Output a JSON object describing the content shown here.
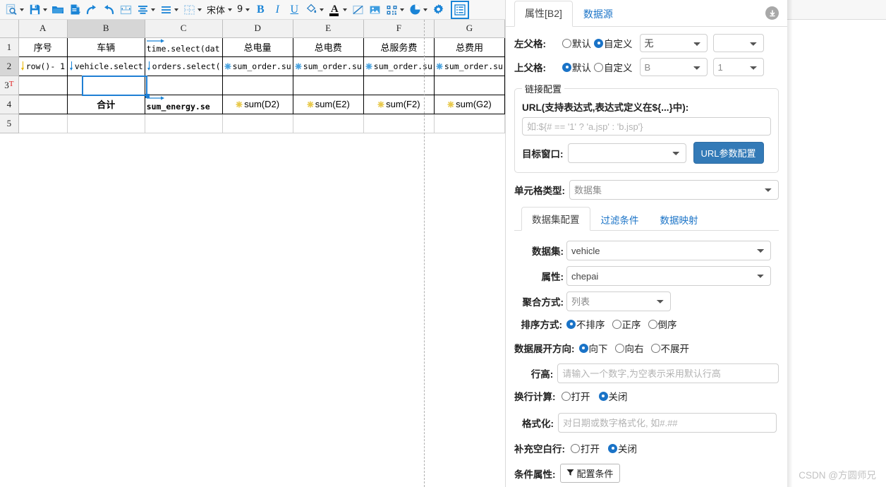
{
  "toolbar": {
    "items": [
      {
        "icon": "print-preview-icon",
        "label": "",
        "caret": true
      },
      {
        "icon": "save-icon",
        "label": "",
        "caret": true
      },
      {
        "icon": "open-folder-icon",
        "label": "",
        "caret": false
      },
      {
        "icon": "new-report-icon",
        "label": "",
        "caret": false
      },
      {
        "icon": "redo-icon",
        "label": "",
        "caret": false
      },
      {
        "icon": "undo-icon",
        "label": "",
        "caret": false
      },
      {
        "icon": "merge-cells-icon",
        "label": "",
        "caret": false
      },
      {
        "icon": "align-center-icon",
        "label": "",
        "caret": true
      },
      {
        "icon": "align-justify-icon",
        "label": "",
        "caret": true
      },
      {
        "icon": "border-icon",
        "label": "",
        "caret": true
      },
      {
        "icon": "font-family-select",
        "label": "宋体",
        "caret": true
      },
      {
        "icon": "font-size-select",
        "label": "9",
        "caret": true
      },
      {
        "icon": "bold-icon",
        "label": "B",
        "caret": false
      },
      {
        "icon": "italic-icon",
        "label": "I",
        "caret": false
      },
      {
        "icon": "underline-icon",
        "label": "U",
        "caret": false
      },
      {
        "icon": "fill-color-icon",
        "label": "",
        "caret": true
      },
      {
        "icon": "font-color-icon",
        "label": "A",
        "caret": true
      },
      {
        "icon": "clear-format-icon",
        "label": "",
        "caret": false
      },
      {
        "icon": "insert-image-icon",
        "label": "",
        "caret": false
      },
      {
        "icon": "barcode-icon",
        "label": "",
        "caret": true
      },
      {
        "icon": "chart-icon",
        "label": "",
        "caret": true
      },
      {
        "icon": "settings-gear-icon",
        "label": "",
        "caret": false
      },
      {
        "icon": "properties-panel-icon",
        "label": "",
        "caret": false
      }
    ],
    "font_family": "宋体",
    "font_size": "9",
    "bold_label": "B",
    "italic_label": "I",
    "underline_label": "U",
    "font_color_label": "A"
  },
  "sheet": {
    "columns": [
      "A",
      "B",
      "C",
      "D",
      "E",
      "F",
      "G"
    ],
    "selected_column": "B",
    "rows": [
      {
        "num": "1",
        "tmark": ""
      },
      {
        "num": "2",
        "tmark": ""
      },
      {
        "num": "3",
        "tmark": "T"
      },
      {
        "num": "4",
        "tmark": ""
      },
      {
        "num": "5",
        "tmark": ""
      }
    ],
    "selected_row": "2",
    "selected_cell": "B2",
    "cells": {
      "A1": "序号",
      "B1": "车辆",
      "C1": "time.select(dat",
      "D1": "总电量",
      "E1": "总电费",
      "F1": "总服务费",
      "G1": "总费用",
      "A2": "row()- 1",
      "B2": "vehicle.select",
      "C2": "orders.select(",
      "D2": "sum_order.su",
      "E2": "sum_order.su",
      "F2": "sum_order.su",
      "G2": "sum_order.su",
      "B4": "合计",
      "C4": "sum_energy.se",
      "D4": "sum(D2)",
      "E4": "sum(E2)",
      "F4": "sum(F2)",
      "G4": "sum(G2)"
    }
  },
  "panel": {
    "tabs": [
      {
        "label": "属性[B2]",
        "active": true
      },
      {
        "label": "数据源",
        "active": false
      }
    ],
    "collapse_icon": "download-circle-icon",
    "left_parent": {
      "label": "左父格:",
      "options": [
        {
          "label": "默认",
          "selected": false
        },
        {
          "label": "自定义",
          "selected": true
        }
      ],
      "cell_value": "无",
      "index_value": ""
    },
    "top_parent": {
      "label": "上父格:",
      "options": [
        {
          "label": "默认",
          "selected": true
        },
        {
          "label": "自定义",
          "selected": false
        }
      ],
      "cell_value": "B",
      "index_value": "1"
    },
    "link_config": {
      "legend": "链接配置",
      "url_title": "URL(支持表达式,表达式定义在${...}中):",
      "url_value": "",
      "url_placeholder": "如:${# == '1' ? 'a.jsp' : 'b.jsp'}",
      "target_label": "目标窗口:",
      "target_value": "",
      "param_button": "URL参数配置"
    },
    "cell_type": {
      "label": "单元格类型:",
      "value": "数据集"
    },
    "subtabs": [
      {
        "label": "数据集配置",
        "active": true
      },
      {
        "label": "过滤条件",
        "active": false
      },
      {
        "label": "数据映射",
        "active": false
      }
    ],
    "dataset": {
      "label": "数据集:",
      "value": "vehicle"
    },
    "attribute": {
      "label": "属性:",
      "value": "chepai"
    },
    "aggregation": {
      "label": "聚合方式:",
      "value": "列表"
    },
    "sort": {
      "label": "排序方式:",
      "options": [
        {
          "label": "不排序",
          "selected": true
        },
        {
          "label": "正序",
          "selected": false
        },
        {
          "label": "倒序",
          "selected": false
        }
      ]
    },
    "expand_dir": {
      "label": "数据展开方向:",
      "options": [
        {
          "label": "向下",
          "selected": true
        },
        {
          "label": "向右",
          "selected": false
        },
        {
          "label": "不展开",
          "selected": false
        }
      ]
    },
    "row_height": {
      "label": "行高:",
      "value": "",
      "placeholder": "请输入一个数字,为空表示采用默认行高"
    },
    "wrap_calc": {
      "label": "换行计算:",
      "options": [
        {
          "label": "打开",
          "selected": false
        },
        {
          "label": "关闭",
          "selected": true
        }
      ]
    },
    "format": {
      "label": "格式化:",
      "value": "",
      "placeholder": "对日期或数字格式化, 如#.##"
    },
    "fill_blank": {
      "label": "补充空白行:",
      "options": [
        {
          "label": "打开",
          "selected": false
        },
        {
          "label": "关闭",
          "selected": true
        }
      ]
    },
    "cond_attr": {
      "label": "条件属性:",
      "button": "配置条件",
      "button_icon": "funnel-icon"
    }
  },
  "watermark": "CSDN @方圆师兄",
  "colors": {
    "accent": "#1a84d6",
    "tab_link": "#1a73c7",
    "button_blue": "#337ab7",
    "marker_yellow": "#e8b600",
    "marker_blue": "#1a84d6",
    "t_marker_red": "#e02020"
  }
}
